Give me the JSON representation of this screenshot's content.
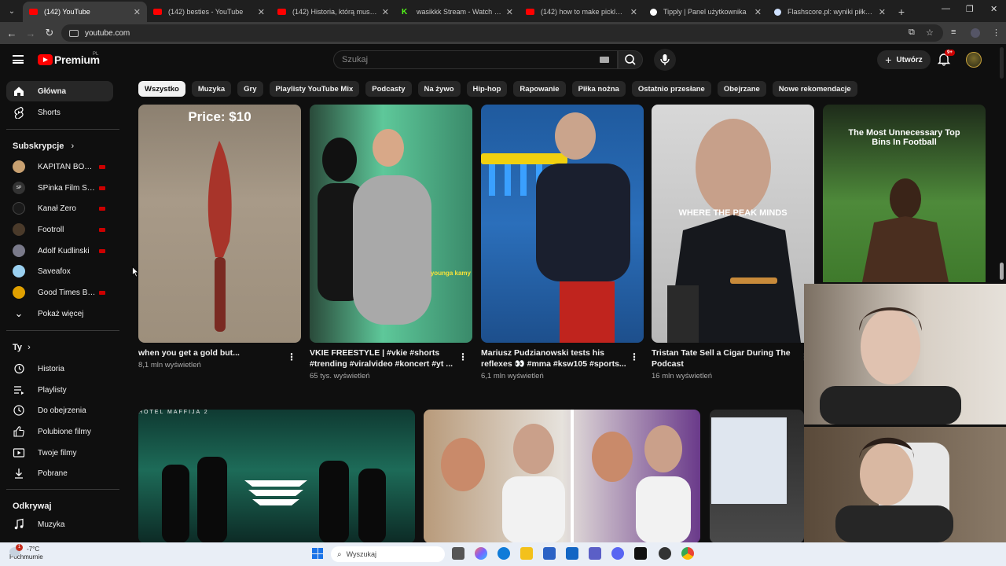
{
  "browser": {
    "tabs": [
      {
        "title": "(142) YouTube",
        "icon": "youtube-icon",
        "active": true
      },
      {
        "title": "(142) besties - YouTube",
        "icon": "youtube-icon"
      },
      {
        "title": "(142) Historia, którą musisz zna",
        "icon": "youtube-icon"
      },
      {
        "title": "wasikkk Stream - Watch Live o",
        "icon": "kick-icon"
      },
      {
        "title": "(142) how to make pickle peps",
        "icon": "youtube-icon"
      },
      {
        "title": "Tipply | Panel użytkownika",
        "icon": "tipply-icon"
      },
      {
        "title": "Flashscore.pl: wyniki piłki nożn",
        "icon": "flashscore-icon"
      }
    ],
    "url": "youtube.com"
  },
  "header": {
    "logo_text": "Premium",
    "logo_country": "PL",
    "search_placeholder": "Szukaj",
    "create_label": "Utwórz",
    "notif_badge": "9+"
  },
  "sidebar": {
    "main": [
      {
        "label": "Główna",
        "icon": "home-icon",
        "active": true
      },
      {
        "label": "Shorts",
        "icon": "shorts-icon"
      }
    ],
    "subs_heading": "Subskrypcje",
    "subs": [
      {
        "label": "KAPITAN BOMB...",
        "color": "#c8a070",
        "live": true
      },
      {
        "label": "SPinka Film Stud...",
        "color": "#333333",
        "live": true
      },
      {
        "label": "Kanał Zero",
        "color": "#1a1a1a",
        "live": true
      },
      {
        "label": "Footroll",
        "color": "#4a3a2a",
        "live": true
      },
      {
        "label": "Adolf Kudlinski",
        "color": "#7a7a8a",
        "live": true
      },
      {
        "label": "Saveafox",
        "color": "#9ad0f0",
        "live": false
      },
      {
        "label": "Good Times Bad Ti...",
        "color": "#e0a000",
        "live": true
      }
    ],
    "show_more": "Pokaż więcej",
    "you_heading": "Ty",
    "you": [
      {
        "label": "Historia",
        "icon": "history-icon"
      },
      {
        "label": "Playlisty",
        "icon": "playlist-icon"
      },
      {
        "label": "Do obejrzenia",
        "icon": "clock-icon"
      },
      {
        "label": "Polubione filmy",
        "icon": "thumbs-up-icon"
      },
      {
        "label": "Twoje filmy",
        "icon": "your-videos-icon"
      },
      {
        "label": "Pobrane",
        "icon": "download-icon"
      }
    ],
    "explore_heading": "Odkrywaj",
    "explore": [
      {
        "label": "Muzyka",
        "icon": "music-icon"
      }
    ]
  },
  "chips": [
    "Wszystko",
    "Muzyka",
    "Gry",
    "Playlisty YouTube Mix",
    "Podcasty",
    "Na żywo",
    "Hip-hop",
    "Rapowanie",
    "Piłka nożna",
    "Ostatnio przesłane",
    "Obejrzane",
    "Nowe rekomendacje"
  ],
  "shorts": [
    {
      "title": "when you get a gold but...",
      "views": "8,1 mln wyświetleń",
      "caption": "Price: $10"
    },
    {
      "title": "VKIE FREESTYLE | #vkie #shorts #trending #viralvideo #koncert #yt ...",
      "views": "65 tys. wyświetleń",
      "caption": "younga kamy"
    },
    {
      "title": "Mariusz Pudzianowski tests his reflexes 👀 #mma #ksw105 #sports...",
      "views": "6,1 mln wyświetleń",
      "caption": ""
    },
    {
      "title": "Tristan Tate Sell a Cigar During The Podcast",
      "views": "16 mln wyświetleń",
      "caption": "WHERE THE PEAK MINDS"
    },
    {
      "title": "",
      "views": "",
      "caption": "The Most Unnecessary Top Bins In Football"
    }
  ],
  "videos": [
    {
      "caption": "HOTEL MAFFIJA 2"
    }
  ],
  "taskbar": {
    "temp": "-7°C",
    "weather": "Pochmurnie",
    "weather_badge": "1",
    "search_placeholder": "Wyszukaj"
  }
}
